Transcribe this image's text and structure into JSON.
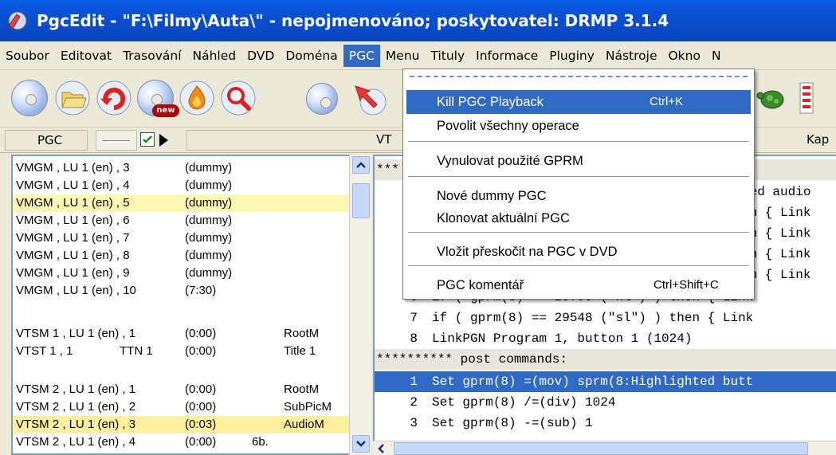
{
  "window": {
    "title": "PgcEdit -   \"F:\\Filmy\\Auta\\\" - nepojmenováno; poskytovatel: DRMP 3.1.4"
  },
  "menubar": [
    "Soubor",
    "Editovat",
    "Trasování",
    "Náhled",
    "DVD",
    "Doména",
    "PGC",
    "Menu",
    "Tituly",
    "Informace",
    "Pluginy",
    "Nástroje",
    "Okno",
    "N"
  ],
  "active_menu": "PGC",
  "pgc_menu": {
    "items": [
      {
        "label": "Kill PGC Playback",
        "shortcut": "Ctrl+K"
      },
      {
        "label": "Povolit všechny operace",
        "shortcut": ""
      },
      {
        "label": "Vynulovat použité GPRM",
        "shortcut": ""
      },
      {
        "label": "Nové dummy PGC",
        "shortcut": ""
      },
      {
        "label": "Klonovat aktuální PGC",
        "shortcut": ""
      },
      {
        "label": "Vložit přeskočit na PGC v DVD",
        "shortcut": ""
      },
      {
        "label": "PGC komentář",
        "shortcut": "Ctrl+Shift+C"
      }
    ]
  },
  "header": {
    "pgc_label": "PGC",
    "vt_label": "VT",
    "kap_label": "Kap"
  },
  "pgc_list": [
    {
      "name": "VMGM , LU 1 (en) , 3",
      "time": "(dummy)",
      "extra": ""
    },
    {
      "name": "VMGM , LU 1 (en) , 4",
      "time": "(dummy)",
      "extra": ""
    },
    {
      "name": "VMGM , LU 1 (en) , 5",
      "time": "(dummy)",
      "extra": ""
    },
    {
      "name": "VMGM , LU 1 (en) , 6",
      "time": "(dummy)",
      "extra": ""
    },
    {
      "name": "VMGM , LU 1 (en) , 7",
      "time": "(dummy)",
      "extra": ""
    },
    {
      "name": "VMGM , LU 1 (en) , 8",
      "time": "(dummy)",
      "extra": ""
    },
    {
      "name": "VMGM , LU 1 (en) , 9",
      "time": "(dummy)",
      "extra": ""
    },
    {
      "name": "VMGM , LU 1 (en) , 10",
      "time": "(7:30)",
      "extra": ""
    },
    {
      "name": "VTSM 1 , LU 1 (en) , 1",
      "time": "(0:00)",
      "extra": "RootM"
    },
    {
      "name": "VTST 1 , 1",
      "ttn": "TTN 1",
      "time": "(0:00)",
      "extra": "Title 1"
    },
    {
      "name": "VTSM 2 , LU 1 (en) , 1",
      "time": "(0:00)",
      "extra": "RootM"
    },
    {
      "name": "VTSM 2 , LU 1 (en) , 2",
      "time": "(0:00)",
      "extra": "SubPicM"
    },
    {
      "name": "VTSM 2 , LU 1 (en) , 3",
      "time": "(0:03)",
      "extra": "AudioM"
    },
    {
      "name": "VTSM 2 , LU 1 (en) , 4",
      "time": "(0:00)",
      "extra": "6b."
    }
  ],
  "code": {
    "top_stars": "***",
    "partial": [
      {
        "y_row": 0,
        "text": "red audio"
      },
      {
        "text": "en { Link"
      },
      {
        "text": "en { Link"
      },
      {
        "text": "en { Link"
      },
      {
        "text": "en { Link"
      }
    ],
    "line6": {
      "num": "6",
      "text": "if ( gprm(8) == 29799 (\"hl\") ) then { Link"
    },
    "line7": {
      "num": "7",
      "text": "if ( gprm(8) == 29548 (\"sl\") ) then { Link"
    },
    "line8": {
      "num": "8",
      "text": "LinkPGN Program 1, button 1 (1024)"
    },
    "post_header": "********** post commands:",
    "post": [
      {
        "num": "1",
        "text": "Set gprm(8) =(mov) sprm(8:Highlighted butt"
      },
      {
        "num": "2",
        "text": "Set gprm(8) /=(div) 1024"
      },
      {
        "num": "3",
        "text": "Set gprm(8) -=(sub) 1"
      }
    ]
  }
}
